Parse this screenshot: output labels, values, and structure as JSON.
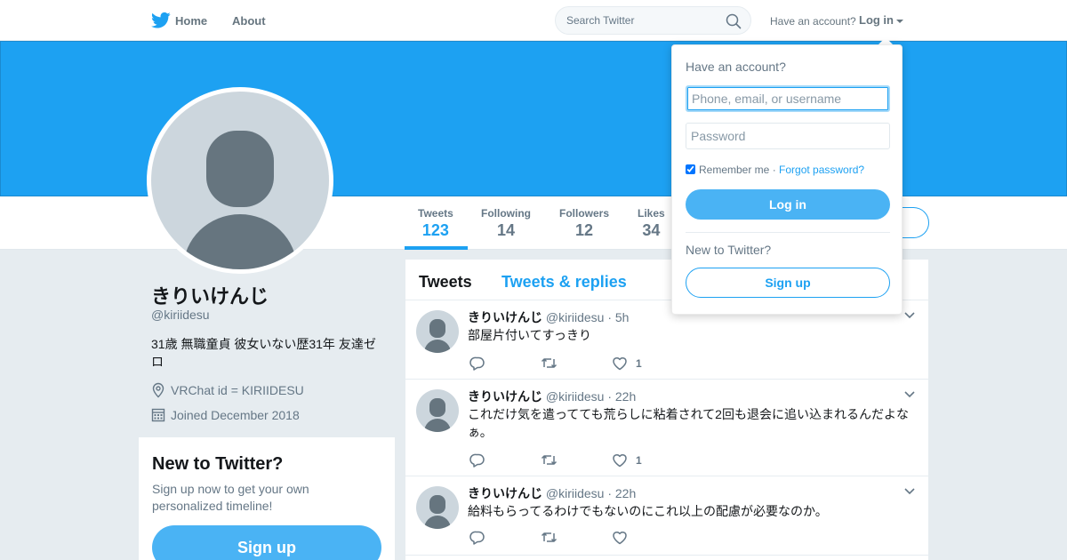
{
  "topbar": {
    "home_label": "Home",
    "about_label": "About",
    "search_placeholder": "Search Twitter",
    "have_account": "Have an account?",
    "login_label": "Log in"
  },
  "profile": {
    "name": "きりいけんじ",
    "handle": "@kiriidesu",
    "bio": "31歳 無職童貞 彼女いない歴31年 友達ゼロ",
    "location": "VRChat id = KIRIIDESU",
    "joined": "Joined December 2018"
  },
  "stats": [
    {
      "label": "Tweets",
      "value": "123"
    },
    {
      "label": "Following",
      "value": "14"
    },
    {
      "label": "Followers",
      "value": "12"
    },
    {
      "label": "Likes",
      "value": "34"
    }
  ],
  "signup_card": {
    "title": "New to Twitter?",
    "text": "Sign up now to get your own personalized timeline!",
    "button": "Sign up"
  },
  "timeline": {
    "tabs": [
      "Tweets",
      "Tweets & replies"
    ],
    "tweets": [
      {
        "name": "きりいけんじ",
        "meta": "@kiriidesu · 5h",
        "text": "部屋片付いてすっきり",
        "likes": "1"
      },
      {
        "name": "きりいけんじ",
        "meta": "@kiriidesu · 22h",
        "text": "これだけ気を遣ってても荒らしに粘着されて2回も退会に追い込まれるんだよなぁ。",
        "likes": "1"
      },
      {
        "name": "きりいけんじ",
        "meta": "@kiriidesu · 22h",
        "text": "給料もらってるわけでもないのにこれ以上の配慮が必要なのか。",
        "likes": ""
      }
    ]
  },
  "login_dropdown": {
    "title": "Have an account?",
    "username_placeholder": "Phone, email, or username",
    "password_placeholder": "Password",
    "remember": "Remember me",
    "separator": " · ",
    "forgot": "Forgot password?",
    "login_button": "Log in",
    "new_to_twitter": "New to Twitter?",
    "signup_button": "Sign up"
  },
  "colors": {
    "brand": "#1da1f2",
    "button": "#4ab3f4",
    "background": "#e6ecf0"
  }
}
